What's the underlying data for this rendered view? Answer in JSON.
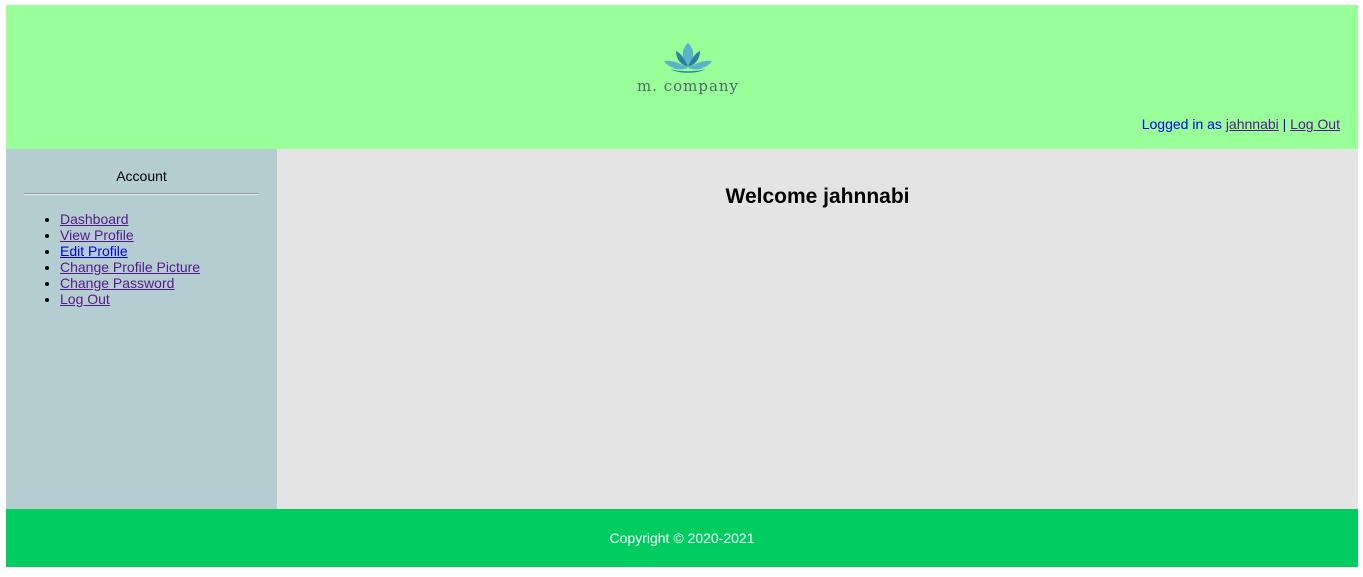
{
  "header": {
    "logo_text": "m. company",
    "logged_in_prefix": "Logged in as",
    "username": "jahnnabi",
    "separator": "|",
    "logout_label": "Log Out"
  },
  "sidebar": {
    "title": "Account",
    "items": [
      {
        "label": "Dashboard"
      },
      {
        "label": "View Profile"
      },
      {
        "label": "Edit Profile"
      },
      {
        "label": "Change Profile Picture"
      },
      {
        "label": "Change Password"
      },
      {
        "label": "Log Out"
      }
    ]
  },
  "main": {
    "welcome": "Welcome jahnnabi"
  },
  "footer": {
    "copyright": "Copyright © 2020-2021"
  },
  "colors": {
    "header_bg": "#99ff99",
    "sidebar_bg": "#b3cdd0",
    "content_bg": "#e4e4e4",
    "footer_bg": "#00cc60"
  }
}
